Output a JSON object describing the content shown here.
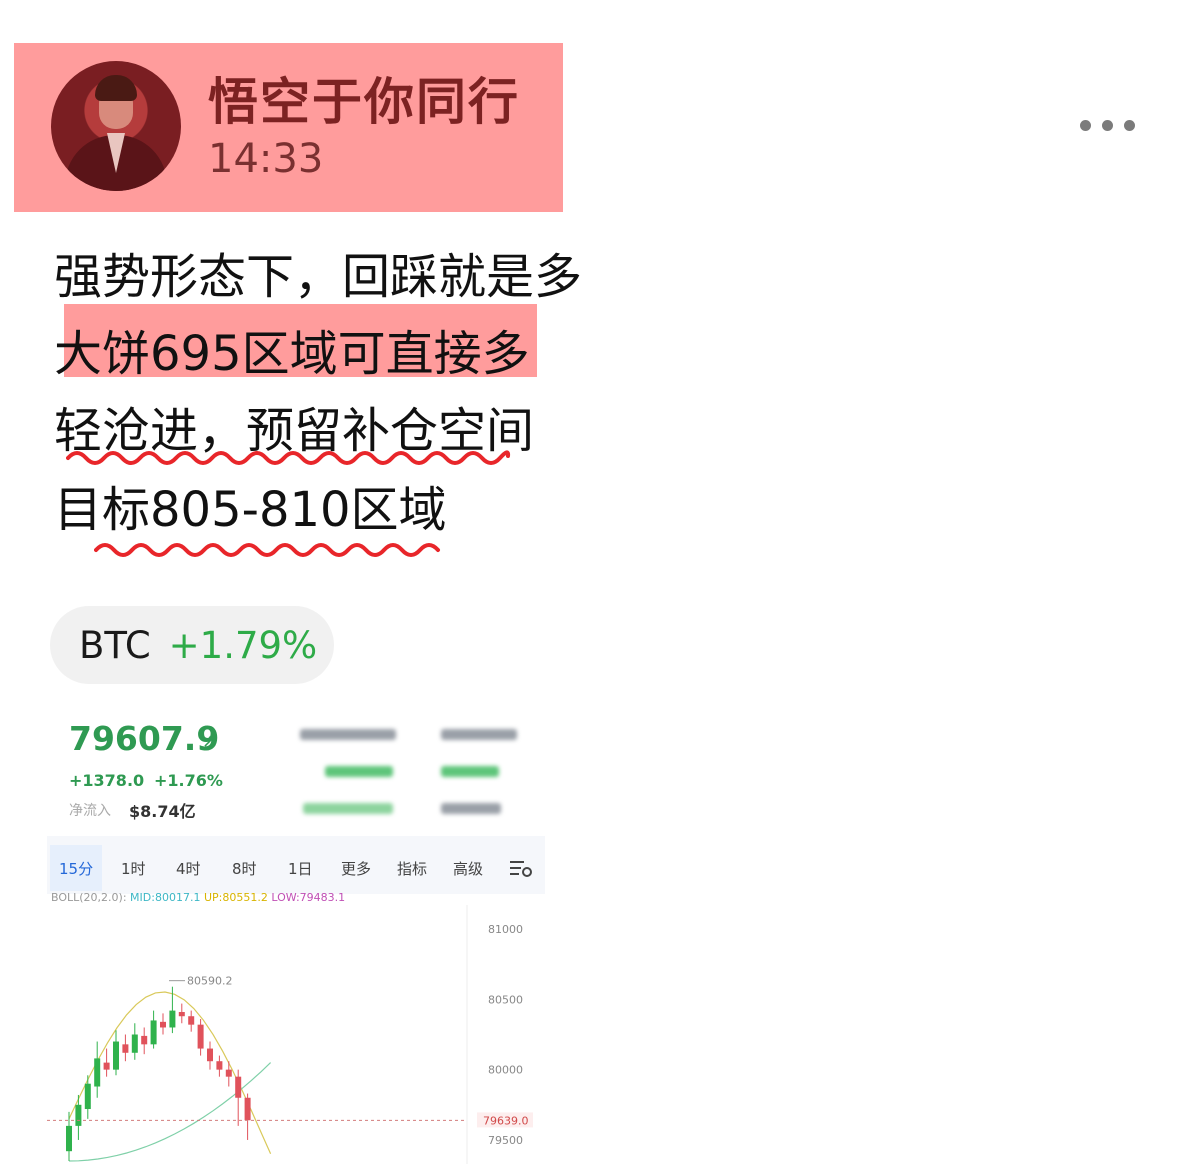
{
  "header": {
    "username": "悟空于你同行",
    "time": "14:33",
    "more_icon": "more-dots-icon"
  },
  "post": {
    "lines": [
      "强势形态下，回踩就是多",
      "大饼695区域可直接多",
      "轻沧进，预留补仓空间",
      "目标805-810区域"
    ]
  },
  "chip": {
    "symbol": "BTC",
    "change": "+1.79%"
  },
  "card": {
    "price": "79607.9",
    "price_arrow": "↗",
    "change_abs": "+1378.0",
    "change_pct": "+1.76%",
    "inflow_label": "净流入",
    "inflow_value": "$8.74亿",
    "tabs": [
      "15分",
      "1时",
      "4时",
      "8时",
      "1日",
      "更多",
      "指标",
      "高级"
    ],
    "active_tab": "15分",
    "settings_icon": "chart-settings-icon",
    "boll": {
      "label": "BOLL(20,2.0):",
      "mid": "MID:80017.1",
      "up": "UP:80551.2",
      "low": "LOW:79483.1"
    }
  },
  "colors": {
    "highlight": "#ff9c9c",
    "up_green": "#2f9a52",
    "down_red": "#e0525b",
    "squiggle": "#e8262a"
  },
  "chart_data": {
    "type": "candlestick",
    "y_ticks": [
      "81000",
      "80500",
      "80000",
      "79500"
    ],
    "ylim": [
      79400,
      81100
    ],
    "current_price_label": "79639.0",
    "current_price": 79639.0,
    "high_annotation": "80590.2",
    "high_value": 80590.2,
    "candles": [
      {
        "o": 79420,
        "c": 79600,
        "h": 79700,
        "l": 79350
      },
      {
        "o": 79600,
        "c": 79750,
        "h": 79820,
        "l": 79500
      },
      {
        "o": 79720,
        "c": 79900,
        "h": 79960,
        "l": 79650
      },
      {
        "o": 79880,
        "c": 80080,
        "h": 80200,
        "l": 79800
      },
      {
        "o": 80050,
        "c": 80000,
        "h": 80150,
        "l": 79950
      },
      {
        "o": 80000,
        "c": 80200,
        "h": 80280,
        "l": 79960
      },
      {
        "o": 80180,
        "c": 80120,
        "h": 80250,
        "l": 80060
      },
      {
        "o": 80120,
        "c": 80250,
        "h": 80330,
        "l": 80070
      },
      {
        "o": 80240,
        "c": 80180,
        "h": 80300,
        "l": 80110
      },
      {
        "o": 80180,
        "c": 80350,
        "h": 80420,
        "l": 80150
      },
      {
        "o": 80340,
        "c": 80300,
        "h": 80400,
        "l": 80250
      },
      {
        "o": 80300,
        "c": 80420,
        "h": 80590,
        "l": 80260
      },
      {
        "o": 80410,
        "c": 80380,
        "h": 80470,
        "l": 80330
      },
      {
        "o": 80380,
        "c": 80320,
        "h": 80420,
        "l": 80270
      },
      {
        "o": 80320,
        "c": 80150,
        "h": 80360,
        "l": 80100
      },
      {
        "o": 80150,
        "c": 80060,
        "h": 80200,
        "l": 80000
      },
      {
        "o": 80060,
        "c": 80000,
        "h": 80100,
        "l": 79950
      },
      {
        "o": 80000,
        "c": 79950,
        "h": 80060,
        "l": 79880
      },
      {
        "o": 79950,
        "c": 79800,
        "h": 80000,
        "l": 79600
      },
      {
        "o": 79800,
        "c": 79640,
        "h": 79830,
        "l": 79500
      }
    ]
  }
}
